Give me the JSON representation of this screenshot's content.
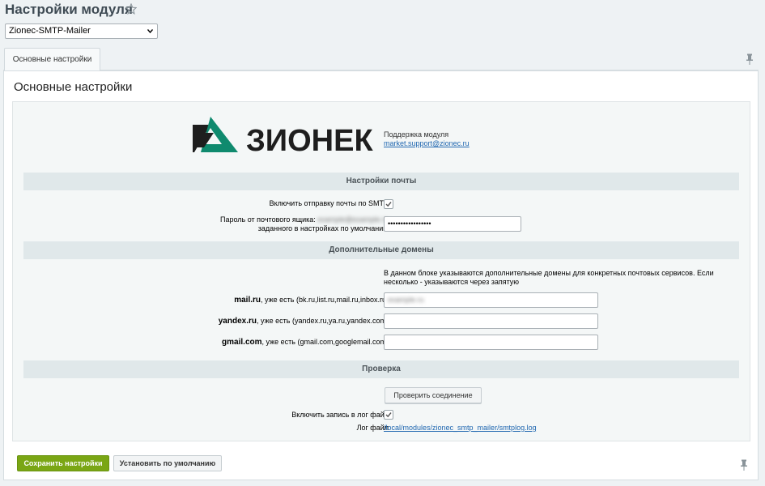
{
  "header": {
    "title": "Настройки модуля"
  },
  "module_select": {
    "value": "Zionec-SMTP-Mailer"
  },
  "tabs": [
    {
      "label": "Основные настройки"
    }
  ],
  "section": {
    "title": "Основные настройки"
  },
  "logo": {
    "text": "ЗИОНЕК",
    "colors": {
      "mark_dark": "#1e1e1e",
      "mark_green": "#0f8a6e",
      "text": "#1e1e1e"
    }
  },
  "support": {
    "label": "Поддержка модуля",
    "email": "market.support@zionec.ru"
  },
  "mail_settings": {
    "heading": "Настройки почты",
    "smtp_label": "Включить отправку почты по SMTP",
    "smtp_checked": true,
    "password_label_line1": "Пароль от почтового ящика:",
    "password_label_email": "example@example.ru",
    "password_label_line2": "заданного в настройках по умолчанию",
    "password_value": "•••••••••••••••••"
  },
  "domains": {
    "heading": "Дополнительные домены",
    "hint": "В данном блоке указываются дополнительные домены для конкретных почтовых сервисов. Если несколько - указываются через запятую",
    "mail_bold": "mail.ru",
    "mail_rest": ", уже есть (bk.ru,list.ru,mail.ru,inbox.ru)",
    "mail_value": "example.ru",
    "yandex_bold": "yandex.ru",
    "yandex_rest": ", уже есть (yandex.ru,ya.ru,yandex.com)",
    "yandex_value": "",
    "gmail_bold": "gmail.com",
    "gmail_rest": ", уже есть (gmail.com,googlemail.com)",
    "gmail_value": ""
  },
  "check": {
    "heading": "Проверка",
    "button": "Проверить соединение",
    "log_label": "Включить запись в лог файл",
    "log_checked": true,
    "logfile_label": "Лог файл",
    "logfile_link": "/local/modules/zionec_smtp_mailer/smtplog.log"
  },
  "footer": {
    "save": "Сохранить настройки",
    "default": "Установить по умолчанию"
  },
  "colors": {
    "accent_green": "#7aa614",
    "link": "#2067b0"
  }
}
